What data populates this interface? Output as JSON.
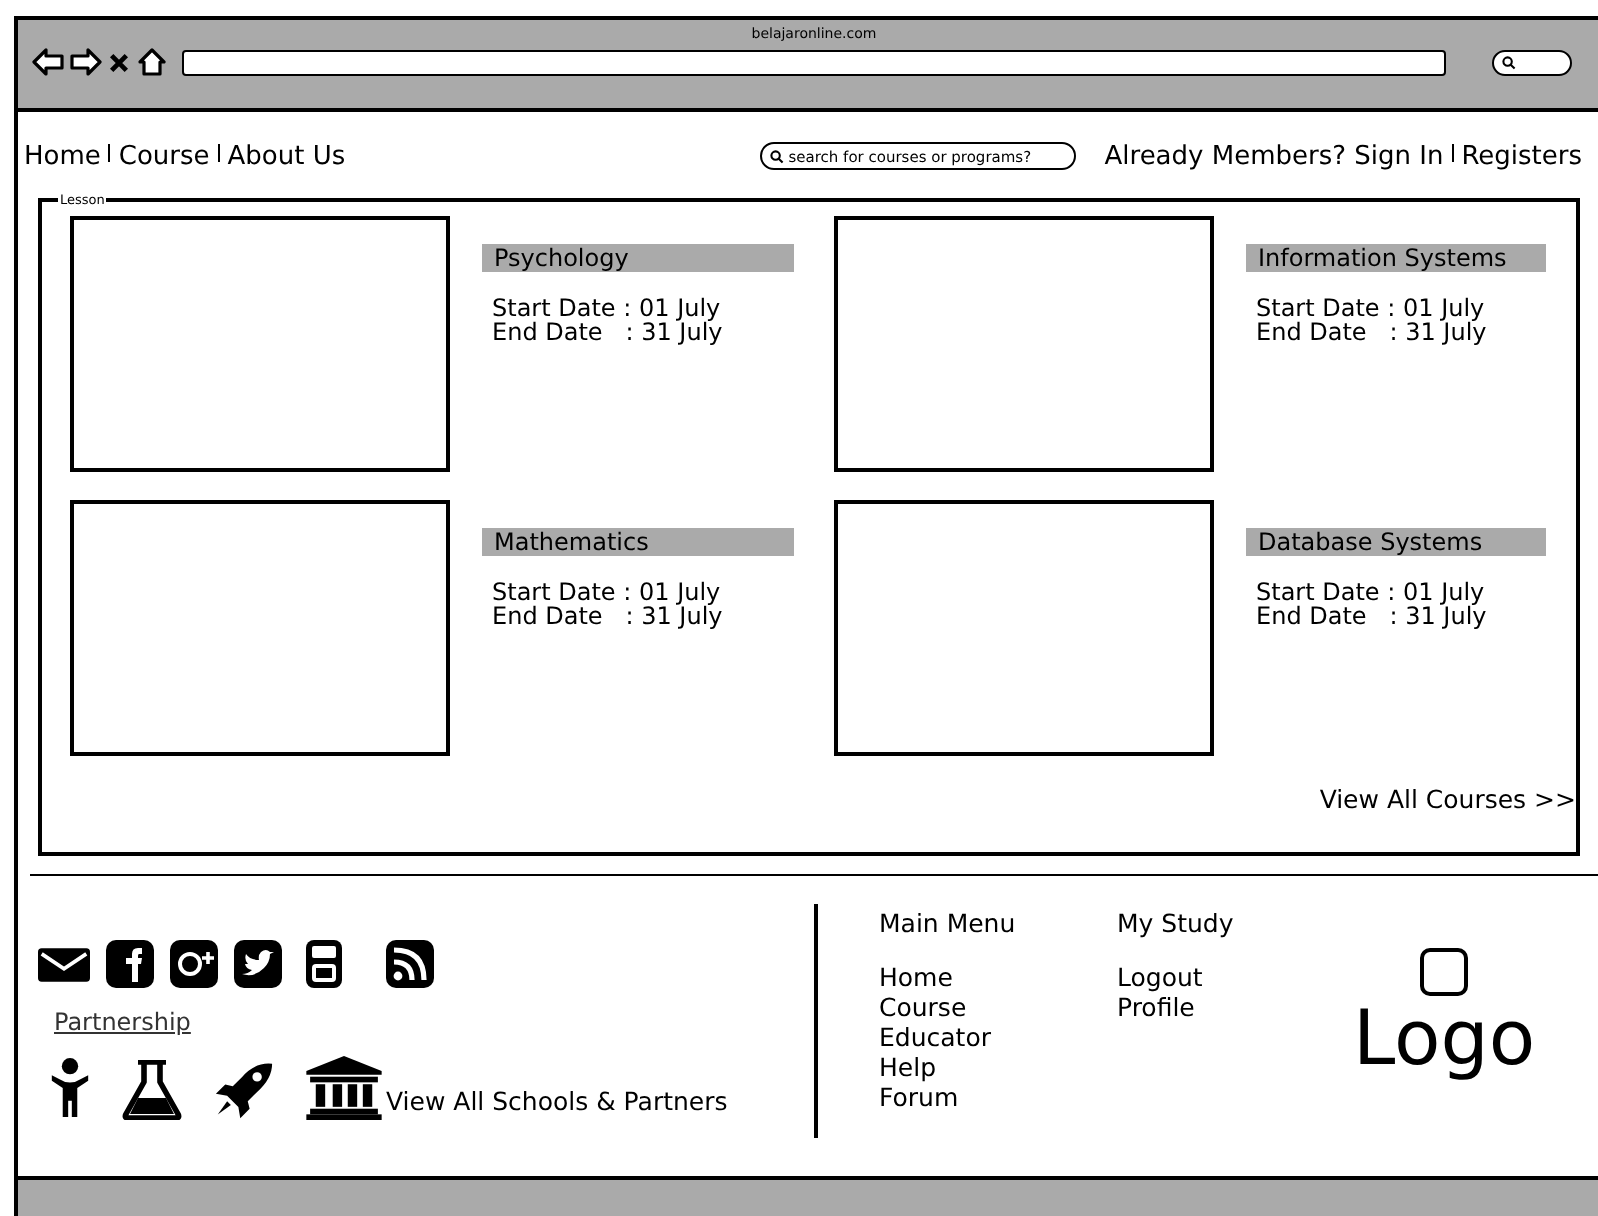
{
  "window": {
    "url": "belajaronline.com"
  },
  "nav": {
    "links": [
      "Home",
      "Course",
      "About Us"
    ]
  },
  "search": {
    "placeholder": "search for courses or programs?"
  },
  "account_links": [
    "Already Members? Sign In",
    "Registers"
  ],
  "lesson": {
    "title": "Lesson",
    "courses": [
      {
        "title": "Psychology",
        "start": "Start Date : 01 July",
        "end": "End Date   : 31 July"
      },
      {
        "title": "Information Systems",
        "start": "Start Date : 01 July",
        "end": "End Date   : 31 July"
      },
      {
        "title": "Mathematics",
        "start": "Start Date : 01 July",
        "end": "End Date   : 31 July"
      },
      {
        "title": "Database Systems",
        "start": "Start Date : 01 July",
        "end": "End Date   : 31 July"
      }
    ],
    "view_all": "View All Courses >>"
  },
  "footer": {
    "partnership": "Partnership",
    "view_all_schools": "View All Schools & Partners",
    "menus": [
      {
        "heading": "Main Menu",
        "items": [
          "Home",
          "Course",
          "Educator",
          "Help",
          "Forum"
        ]
      },
      {
        "heading": "My Study",
        "items": [
          "Logout",
          "Profile"
        ]
      }
    ],
    "logo": "Logo"
  }
}
